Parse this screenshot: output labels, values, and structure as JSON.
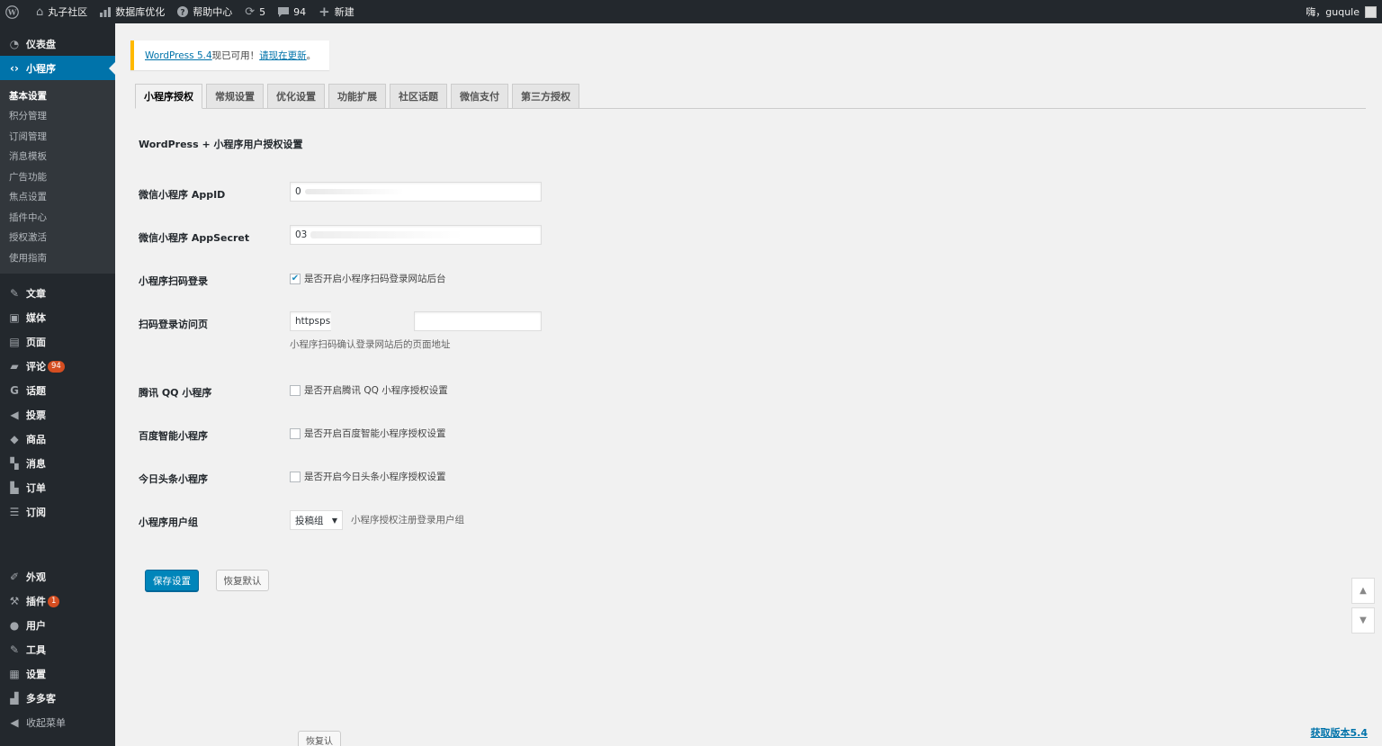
{
  "adminbar": {
    "items": [
      {
        "icon": "wordpress-logo-icon",
        "label": ""
      },
      {
        "icon": "home-icon",
        "label": "丸子社区"
      },
      {
        "icon": "bar-chart-icon",
        "label": "数据库优化"
      },
      {
        "icon": "help-icon",
        "label": "帮助中心"
      },
      {
        "icon": "refresh-icon",
        "label": "5"
      },
      {
        "icon": "comment-icon",
        "label": "94"
      },
      {
        "icon": "plus-icon",
        "label": "新建"
      }
    ],
    "greeting": "嗨，guqule"
  },
  "sidebar": {
    "top_items": [
      {
        "icon": "dashboard-icon",
        "label": "仪表盘"
      },
      {
        "icon": "code-icon",
        "label": "小程序"
      }
    ],
    "submenu": [
      "基本设置",
      "积分管理",
      "订阅管理",
      "消息模板",
      "广告功能",
      "焦点设置",
      "插件中心",
      "授权激活",
      "使用指南"
    ],
    "items": [
      {
        "icon": "pin-icon",
        "label": "文章",
        "badge": ""
      },
      {
        "icon": "media-icon",
        "label": "媒体",
        "badge": ""
      },
      {
        "icon": "page-icon",
        "label": "页面",
        "badge": ""
      },
      {
        "icon": "comment-icon",
        "label": "评论",
        "badge": "94"
      },
      {
        "icon": "topic-icon",
        "label": "话题",
        "badge": ""
      },
      {
        "icon": "megaphone-icon",
        "label": "投票",
        "badge": ""
      },
      {
        "icon": "tag-icon",
        "label": "商品",
        "badge": ""
      },
      {
        "icon": "message-icon",
        "label": "消息",
        "badge": ""
      },
      {
        "icon": "cart-icon",
        "label": "订单",
        "badge": ""
      },
      {
        "icon": "feedback-icon",
        "label": "订阅",
        "badge": ""
      }
    ],
    "items2": [
      {
        "icon": "brush-icon",
        "label": "外观",
        "badge": ""
      },
      {
        "icon": "plugin-icon",
        "label": "插件",
        "badge": "1"
      },
      {
        "icon": "user-icon",
        "label": "用户",
        "badge": ""
      },
      {
        "icon": "wrench-icon",
        "label": "工具",
        "badge": ""
      },
      {
        "icon": "settings-icon",
        "label": "设置",
        "badge": ""
      },
      {
        "icon": "store-icon",
        "label": "多多客",
        "badge": ""
      },
      {
        "icon": "collapse-icon",
        "label": "收起菜单",
        "badge": ""
      }
    ]
  },
  "notice": {
    "link1": "WordPress 5.4",
    "text": "现已可用！",
    "link2": "请现在更新",
    "end": "。"
  },
  "tabs": [
    "小程序授权",
    "常规设置",
    "优化设置",
    "功能扩展",
    "社区话题",
    "微信支付",
    "第三方授权"
  ],
  "section_title": "WordPress + 小程序用户授权设置",
  "form": {
    "appid_label": "微信小程序 AppID",
    "appid_value": "0",
    "appsecret_label": "微信小程序 AppSecret",
    "appsecret_value": "03",
    "scan_login_label": "小程序扫码登录",
    "scan_login_text": "是否开启小程序扫码登录网站后台",
    "scan_page_label": "扫码登录访问页",
    "scan_page_value": "httpsps",
    "scan_page_desc": "小程序扫码确认登录网站后的页面地址",
    "qq_label": "腾讯 QQ 小程序",
    "qq_text": "是否开启腾讯 QQ 小程序授权设置",
    "baidu_label": "百度智能小程序",
    "baidu_text": "是否开启百度智能小程序授权设置",
    "toutiao_label": "今日头条小程序",
    "toutiao_text": "是否开启今日头条小程序授权设置",
    "group_label": "小程序用户组",
    "group_value": "投稿组",
    "group_desc": "小程序授权注册登录用户组"
  },
  "buttons": {
    "save": "保存设置",
    "reset": "恢复默认",
    "reset2": "恢复认"
  },
  "footer": {
    "version_link": "获取版本5.4"
  }
}
